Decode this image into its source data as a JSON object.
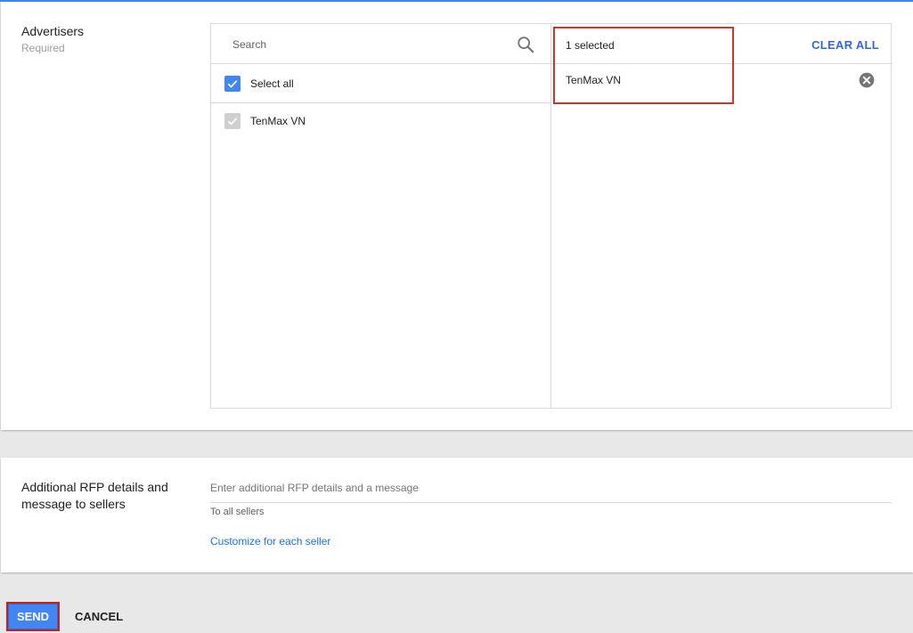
{
  "advertisers": {
    "title": "Advertisers",
    "required_label": "Required",
    "search_placeholder": "Search",
    "select_all_label": "Select all",
    "list_items": [
      "TenMax VN"
    ],
    "selected_count": "1 selected",
    "clear_all_label": "CLEAR ALL",
    "selected_items": [
      "TenMax VN"
    ]
  },
  "rfp": {
    "title_line1": "Additional RFP details and",
    "title_line2": "message to sellers",
    "input_placeholder": "Enter additional RFP details and a message",
    "hint": "To all sellers",
    "customize_link": "Customize for each seller"
  },
  "actions": {
    "send_label": "SEND",
    "cancel_label": "CANCEL"
  },
  "colors": {
    "accent": "#4285f4",
    "link": "#1a73e8",
    "highlight": "#d93025"
  },
  "icons": {
    "search": "search-icon",
    "remove": "close-circle-icon",
    "check": "check-icon"
  }
}
